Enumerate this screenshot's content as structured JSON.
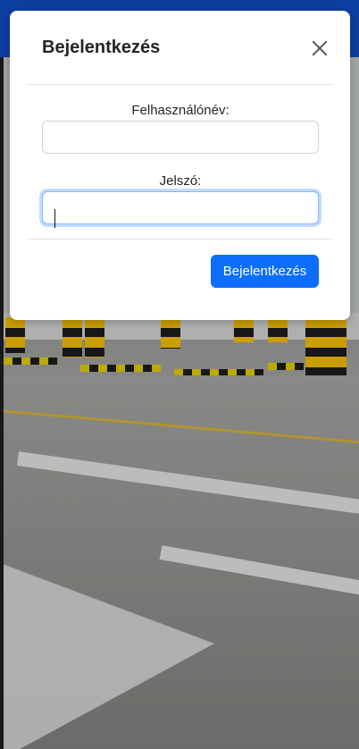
{
  "modal": {
    "title": "Bejelentkezés",
    "username_label": "Felhasználónév:",
    "username_value": "",
    "password_label": "Jelszó:",
    "password_value": "",
    "submit_label": "Bejelentkezés"
  },
  "colors": {
    "top_bar": "#0d3fa0",
    "primary_button": "#0d6efd",
    "focus_border": "#86b7fe"
  },
  "icons": {
    "close": "close-icon"
  }
}
